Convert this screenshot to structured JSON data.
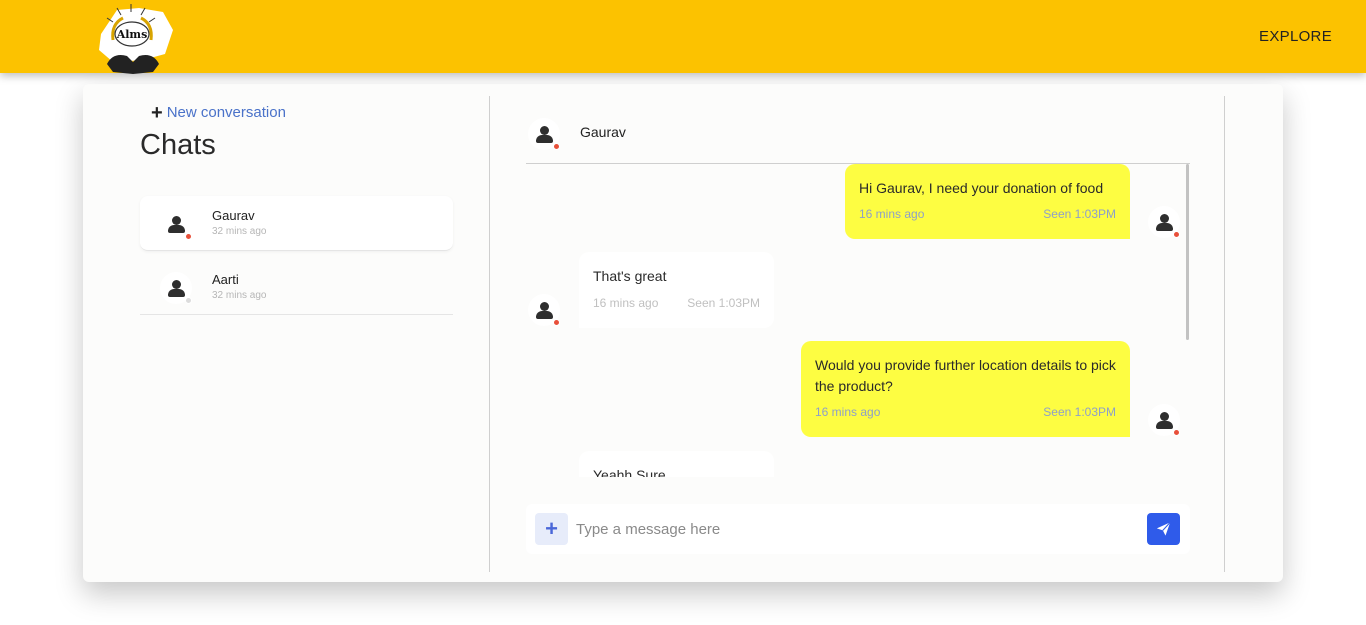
{
  "nav": {
    "explore_label": "EXPLORE",
    "brand": "Alms",
    "brand_color": "#fcc200"
  },
  "sidebar": {
    "new_conversation_label": "New conversation",
    "title": "Chats",
    "contacts": [
      {
        "name": "Gaurav",
        "time": "32 mins ago",
        "status": "online",
        "active": true
      },
      {
        "name": "Aarti",
        "time": "32 mins ago",
        "status": "offline",
        "active": false
      }
    ]
  },
  "chat": {
    "contact_name": "Gaurav",
    "messages": [
      {
        "direction": "out",
        "text": "Hi Gaurav, I need your donation of food",
        "time": "16 mins ago",
        "seen": "Seen 1:03PM"
      },
      {
        "direction": "in",
        "text": "That's great",
        "time": "16 mins ago",
        "seen": "Seen 1:03PM"
      },
      {
        "direction": "out",
        "text": "Would you provide further location details to pick the product?",
        "time": "16 mins ago",
        "seen": "Seen 1:03PM"
      },
      {
        "direction": "in",
        "text": "Yeahh Sure",
        "time": "",
        "seen": ""
      }
    ]
  },
  "composer": {
    "placeholder": "Type a message here",
    "add_icon": "plus-icon",
    "send_icon": "paper-plane-icon"
  }
}
